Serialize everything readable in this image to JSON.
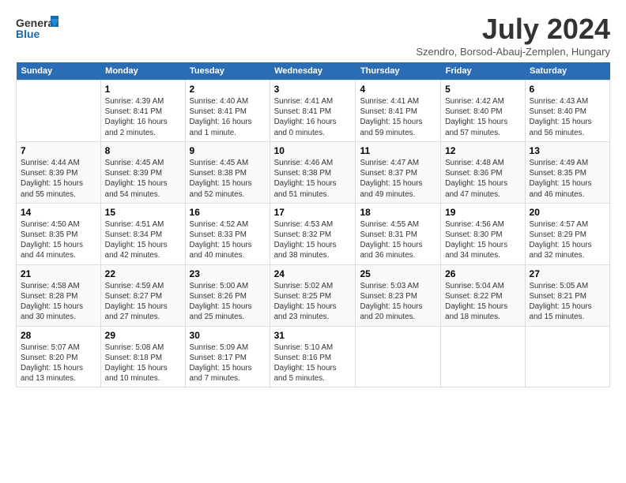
{
  "header": {
    "logo_general": "General",
    "logo_blue": "Blue",
    "month_title": "July 2024",
    "location": "Szendro, Borsod-Abauj-Zemplen, Hungary"
  },
  "days_of_week": [
    "Sunday",
    "Monday",
    "Tuesday",
    "Wednesday",
    "Thursday",
    "Friday",
    "Saturday"
  ],
  "weeks": [
    {
      "days": [
        {
          "date": "",
          "sunrise": "",
          "sunset": "",
          "daylight": ""
        },
        {
          "date": "1",
          "sunrise": "Sunrise: 4:39 AM",
          "sunset": "Sunset: 8:41 PM",
          "daylight": "Daylight: 16 hours and 2 minutes."
        },
        {
          "date": "2",
          "sunrise": "Sunrise: 4:40 AM",
          "sunset": "Sunset: 8:41 PM",
          "daylight": "Daylight: 16 hours and 1 minute."
        },
        {
          "date": "3",
          "sunrise": "Sunrise: 4:41 AM",
          "sunset": "Sunset: 8:41 PM",
          "daylight": "Daylight: 16 hours and 0 minutes."
        },
        {
          "date": "4",
          "sunrise": "Sunrise: 4:41 AM",
          "sunset": "Sunset: 8:41 PM",
          "daylight": "Daylight: 15 hours and 59 minutes."
        },
        {
          "date": "5",
          "sunrise": "Sunrise: 4:42 AM",
          "sunset": "Sunset: 8:40 PM",
          "daylight": "Daylight: 15 hours and 57 minutes."
        },
        {
          "date": "6",
          "sunrise": "Sunrise: 4:43 AM",
          "sunset": "Sunset: 8:40 PM",
          "daylight": "Daylight: 15 hours and 56 minutes."
        }
      ]
    },
    {
      "days": [
        {
          "date": "7",
          "sunrise": "Sunrise: 4:44 AM",
          "sunset": "Sunset: 8:39 PM",
          "daylight": "Daylight: 15 hours and 55 minutes."
        },
        {
          "date": "8",
          "sunrise": "Sunrise: 4:45 AM",
          "sunset": "Sunset: 8:39 PM",
          "daylight": "Daylight: 15 hours and 54 minutes."
        },
        {
          "date": "9",
          "sunrise": "Sunrise: 4:45 AM",
          "sunset": "Sunset: 8:38 PM",
          "daylight": "Daylight: 15 hours and 52 minutes."
        },
        {
          "date": "10",
          "sunrise": "Sunrise: 4:46 AM",
          "sunset": "Sunset: 8:38 PM",
          "daylight": "Daylight: 15 hours and 51 minutes."
        },
        {
          "date": "11",
          "sunrise": "Sunrise: 4:47 AM",
          "sunset": "Sunset: 8:37 PM",
          "daylight": "Daylight: 15 hours and 49 minutes."
        },
        {
          "date": "12",
          "sunrise": "Sunrise: 4:48 AM",
          "sunset": "Sunset: 8:36 PM",
          "daylight": "Daylight: 15 hours and 47 minutes."
        },
        {
          "date": "13",
          "sunrise": "Sunrise: 4:49 AM",
          "sunset": "Sunset: 8:35 PM",
          "daylight": "Daylight: 15 hours and 46 minutes."
        }
      ]
    },
    {
      "days": [
        {
          "date": "14",
          "sunrise": "Sunrise: 4:50 AM",
          "sunset": "Sunset: 8:35 PM",
          "daylight": "Daylight: 15 hours and 44 minutes."
        },
        {
          "date": "15",
          "sunrise": "Sunrise: 4:51 AM",
          "sunset": "Sunset: 8:34 PM",
          "daylight": "Daylight: 15 hours and 42 minutes."
        },
        {
          "date": "16",
          "sunrise": "Sunrise: 4:52 AM",
          "sunset": "Sunset: 8:33 PM",
          "daylight": "Daylight: 15 hours and 40 minutes."
        },
        {
          "date": "17",
          "sunrise": "Sunrise: 4:53 AM",
          "sunset": "Sunset: 8:32 PM",
          "daylight": "Daylight: 15 hours and 38 minutes."
        },
        {
          "date": "18",
          "sunrise": "Sunrise: 4:55 AM",
          "sunset": "Sunset: 8:31 PM",
          "daylight": "Daylight: 15 hours and 36 minutes."
        },
        {
          "date": "19",
          "sunrise": "Sunrise: 4:56 AM",
          "sunset": "Sunset: 8:30 PM",
          "daylight": "Daylight: 15 hours and 34 minutes."
        },
        {
          "date": "20",
          "sunrise": "Sunrise: 4:57 AM",
          "sunset": "Sunset: 8:29 PM",
          "daylight": "Daylight: 15 hours and 32 minutes."
        }
      ]
    },
    {
      "days": [
        {
          "date": "21",
          "sunrise": "Sunrise: 4:58 AM",
          "sunset": "Sunset: 8:28 PM",
          "daylight": "Daylight: 15 hours and 30 minutes."
        },
        {
          "date": "22",
          "sunrise": "Sunrise: 4:59 AM",
          "sunset": "Sunset: 8:27 PM",
          "daylight": "Daylight: 15 hours and 27 minutes."
        },
        {
          "date": "23",
          "sunrise": "Sunrise: 5:00 AM",
          "sunset": "Sunset: 8:26 PM",
          "daylight": "Daylight: 15 hours and 25 minutes."
        },
        {
          "date": "24",
          "sunrise": "Sunrise: 5:02 AM",
          "sunset": "Sunset: 8:25 PM",
          "daylight": "Daylight: 15 hours and 23 minutes."
        },
        {
          "date": "25",
          "sunrise": "Sunrise: 5:03 AM",
          "sunset": "Sunset: 8:23 PM",
          "daylight": "Daylight: 15 hours and 20 minutes."
        },
        {
          "date": "26",
          "sunrise": "Sunrise: 5:04 AM",
          "sunset": "Sunset: 8:22 PM",
          "daylight": "Daylight: 15 hours and 18 minutes."
        },
        {
          "date": "27",
          "sunrise": "Sunrise: 5:05 AM",
          "sunset": "Sunset: 8:21 PM",
          "daylight": "Daylight: 15 hours and 15 minutes."
        }
      ]
    },
    {
      "days": [
        {
          "date": "28",
          "sunrise": "Sunrise: 5:07 AM",
          "sunset": "Sunset: 8:20 PM",
          "daylight": "Daylight: 15 hours and 13 minutes."
        },
        {
          "date": "29",
          "sunrise": "Sunrise: 5:08 AM",
          "sunset": "Sunset: 8:18 PM",
          "daylight": "Daylight: 15 hours and 10 minutes."
        },
        {
          "date": "30",
          "sunrise": "Sunrise: 5:09 AM",
          "sunset": "Sunset: 8:17 PM",
          "daylight": "Daylight: 15 hours and 7 minutes."
        },
        {
          "date": "31",
          "sunrise": "Sunrise: 5:10 AM",
          "sunset": "Sunset: 8:16 PM",
          "daylight": "Daylight: 15 hours and 5 minutes."
        },
        {
          "date": "",
          "sunrise": "",
          "sunset": "",
          "daylight": ""
        },
        {
          "date": "",
          "sunrise": "",
          "sunset": "",
          "daylight": ""
        },
        {
          "date": "",
          "sunrise": "",
          "sunset": "",
          "daylight": ""
        }
      ]
    }
  ]
}
